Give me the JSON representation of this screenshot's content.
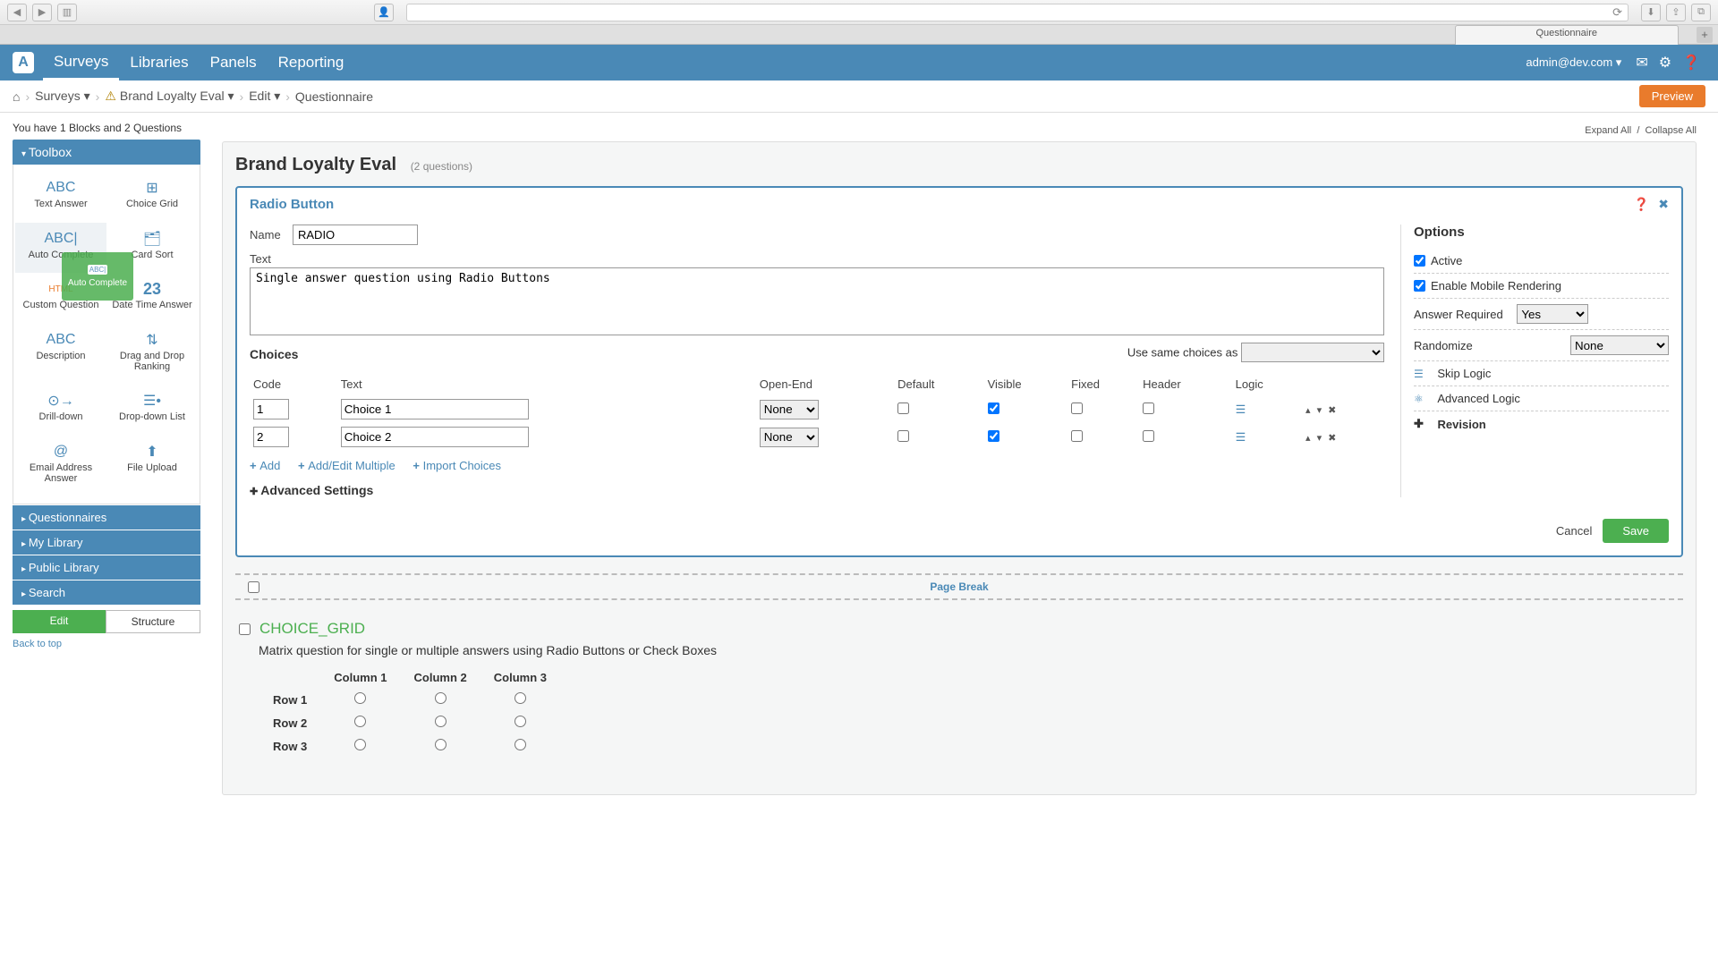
{
  "browser": {
    "tab_label": "Questionnaire"
  },
  "nav": {
    "items": [
      "Surveys",
      "Libraries",
      "Panels",
      "Reporting"
    ],
    "user": "admin@dev.com"
  },
  "breadcrumb": {
    "surveys": "Surveys",
    "survey_name": "Brand Loyalty Eval",
    "edit": "Edit",
    "page": "Questionnaire",
    "preview": "Preview"
  },
  "sidebar": {
    "info": "You have 1 Blocks and 2 Questions",
    "toolbox": "Toolbox",
    "tools": [
      "Text Answer",
      "Choice Grid",
      "Auto Complete",
      "Card Sort",
      "Custom Question",
      "Date Time Answer",
      "Description",
      "Drag and Drop Ranking",
      "Drill-down",
      "Drop-down List",
      "Email Address Answer",
      "File Upload"
    ],
    "drag_label": "Auto Complete",
    "accordion": [
      "Questionnaires",
      "My Library",
      "Public Library",
      "Search"
    ],
    "tab_edit": "Edit",
    "tab_structure": "Structure",
    "back": "Back to top"
  },
  "main": {
    "title": "Brand Loyalty Eval",
    "qcount": "(2 questions)",
    "expand": "Expand All",
    "collapse": "Collapse All"
  },
  "editor": {
    "title": "Radio Button",
    "name_label": "Name",
    "name_value": "RADIO",
    "text_label": "Text",
    "text_value": "Single answer question using Radio Buttons",
    "choices_label": "Choices",
    "same_label": "Use same choices as",
    "cols": {
      "code": "Code",
      "text": "Text",
      "openend": "Open-End",
      "default": "Default",
      "visible": "Visible",
      "fixed": "Fixed",
      "header": "Header",
      "logic": "Logic"
    },
    "rows": [
      {
        "code": "1",
        "text": "Choice 1",
        "openend": "None",
        "visible": true
      },
      {
        "code": "2",
        "text": "Choice 2",
        "openend": "None",
        "visible": true
      }
    ],
    "add": "Add",
    "addmulti": "Add/Edit Multiple",
    "import": "Import Choices",
    "advanced": "Advanced Settings",
    "options_title": "Options",
    "opt_active": "Active",
    "opt_mobile": "Enable Mobile Rendering",
    "opt_required": "Answer Required",
    "opt_required_val": "Yes",
    "opt_random": "Randomize",
    "opt_random_val": "None",
    "opt_skip": "Skip Logic",
    "opt_advlogic": "Advanced Logic",
    "opt_revision": "Revision",
    "cancel": "Cancel",
    "save": "Save"
  },
  "pagebreak": "Page Break",
  "q2": {
    "name": "CHOICE_GRID",
    "desc": "Matrix question for single or multiple answers using Radio Buttons or Check Boxes",
    "cols": [
      "Column 1",
      "Column 2",
      "Column 3"
    ],
    "rows": [
      "Row 1",
      "Row 2",
      "Row 3"
    ]
  }
}
